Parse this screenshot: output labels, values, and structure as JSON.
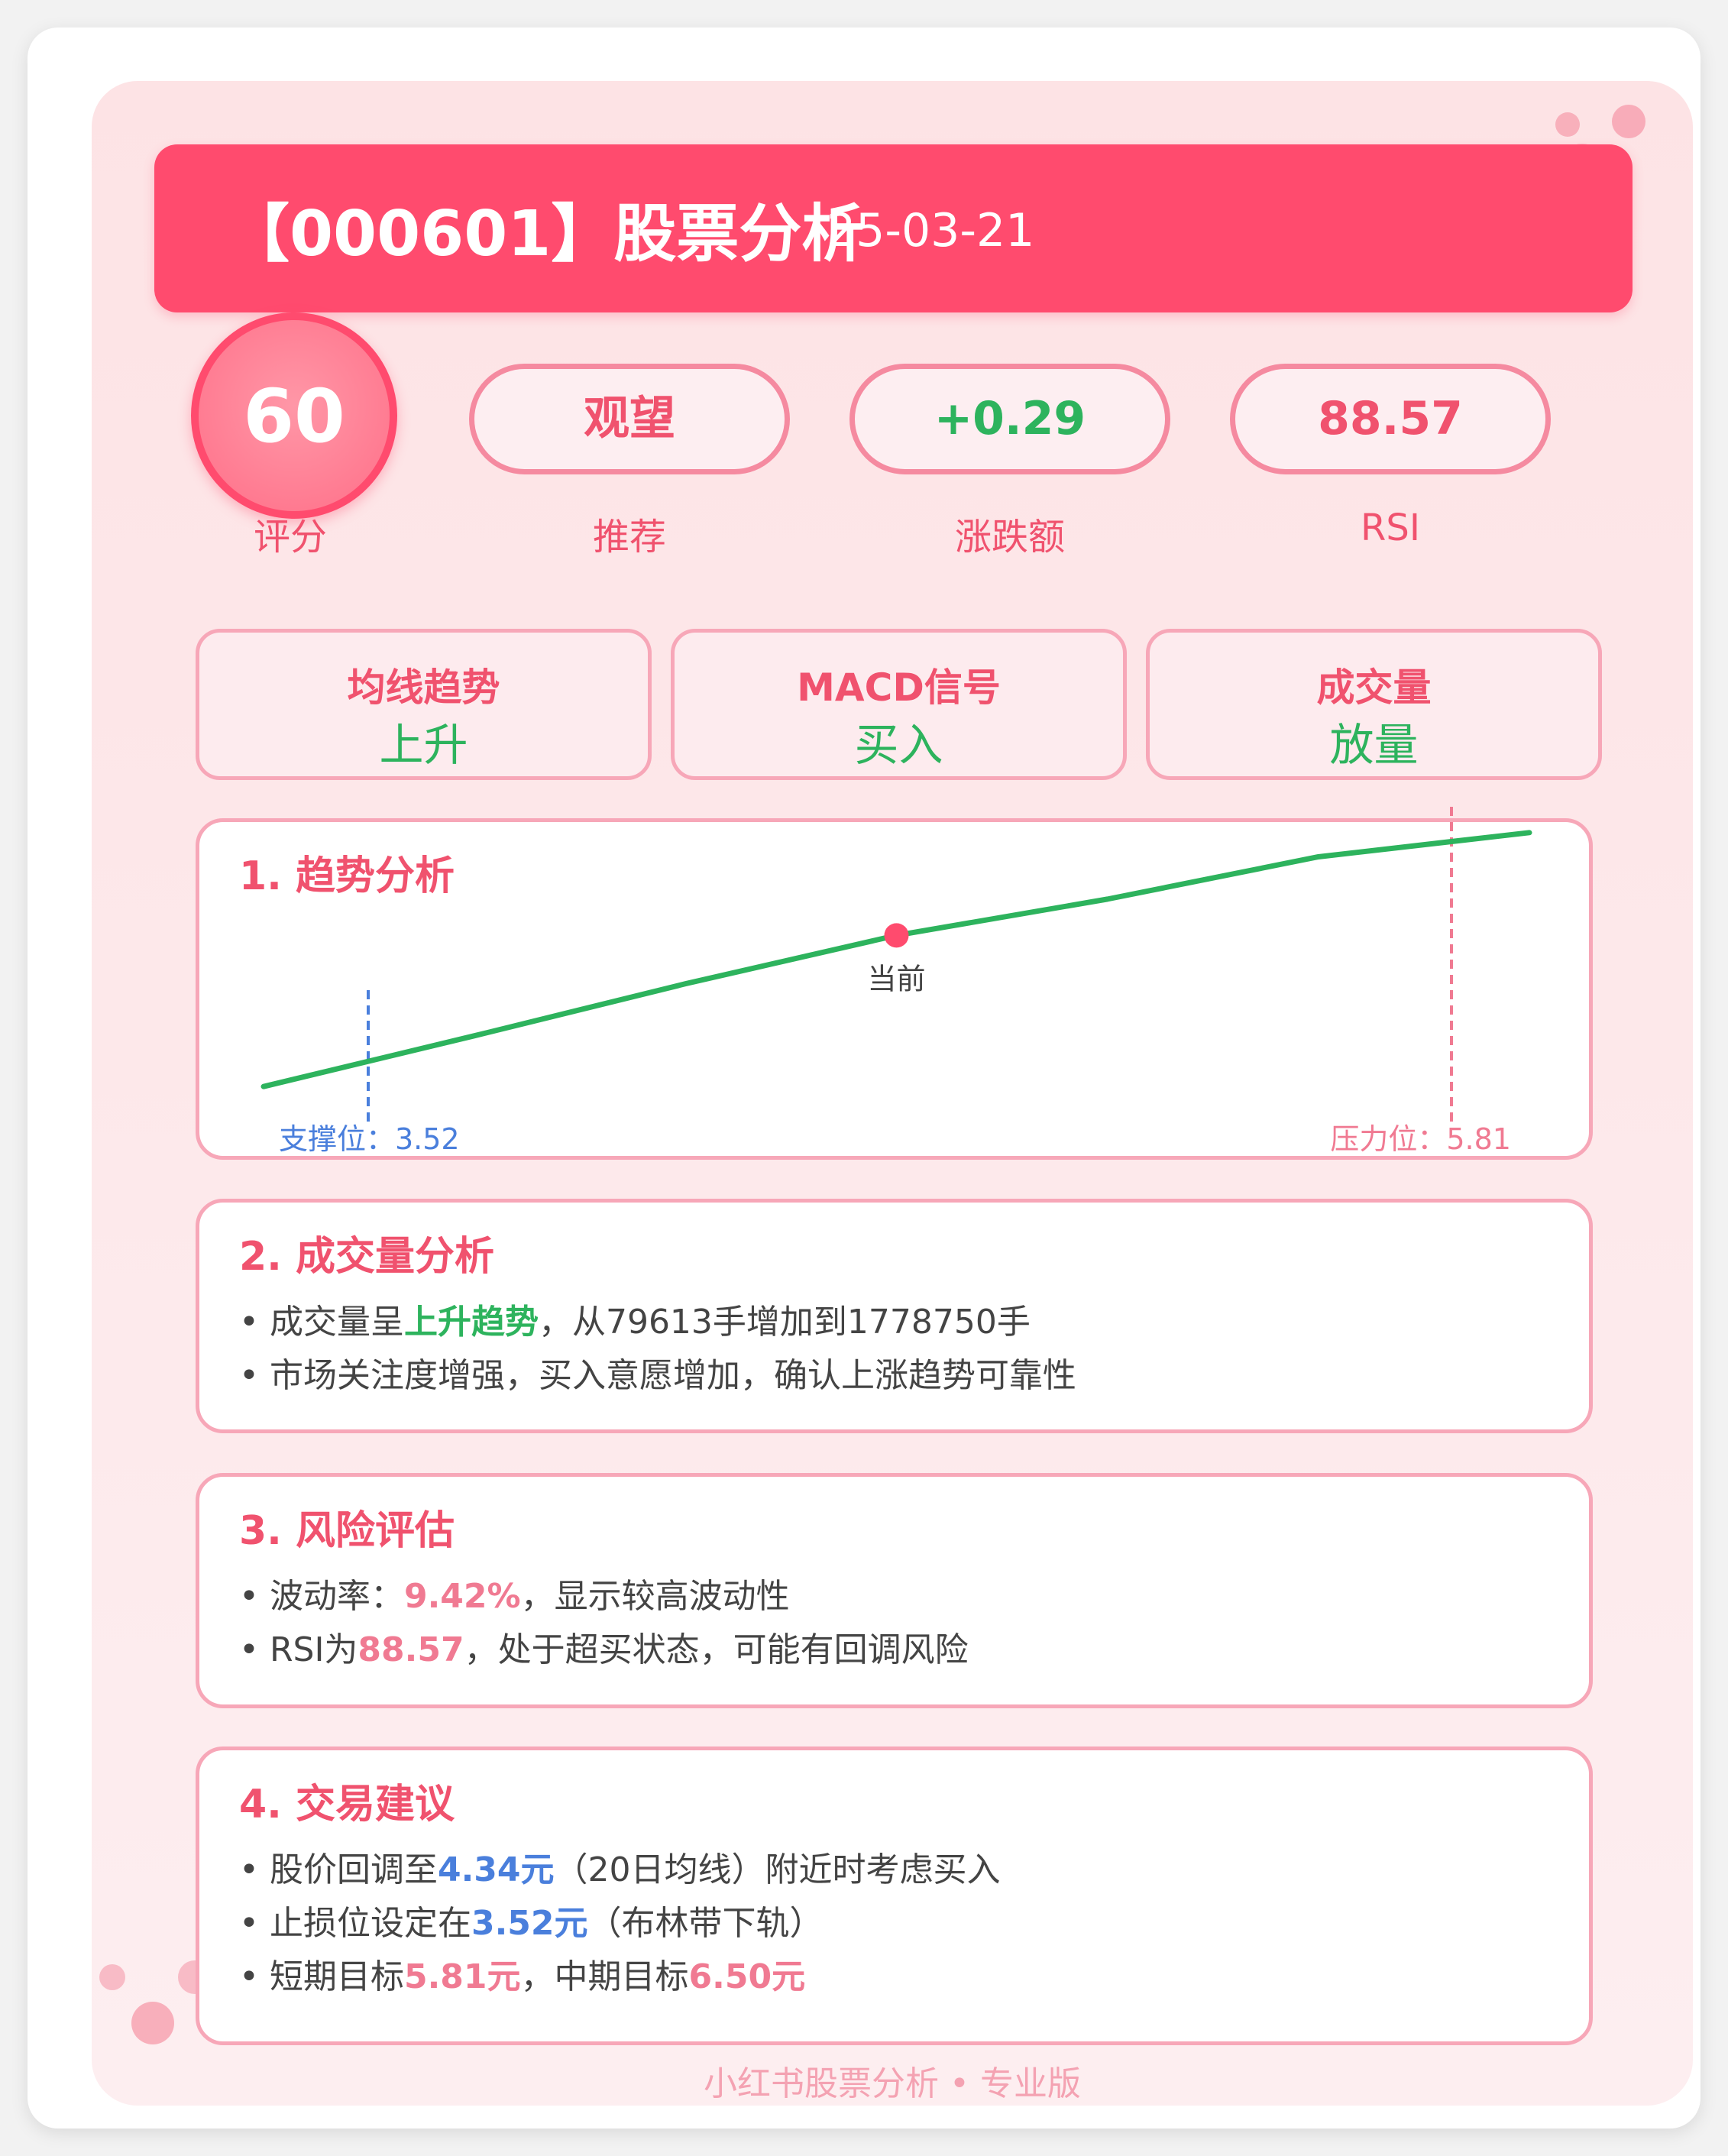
{
  "header": {
    "title": "【000601】股票分析",
    "date": "25-03-21"
  },
  "metrics": {
    "score": {
      "value": "60",
      "label": "评分"
    },
    "recommend": {
      "value": "观望",
      "label": "推荐"
    },
    "change": {
      "value": "+0.29",
      "label": "涨跌额"
    },
    "rsi": {
      "value": "88.57",
      "label": "RSI"
    }
  },
  "signals": [
    {
      "label": "均线趋势",
      "value": "上升"
    },
    {
      "label": "MACD信号",
      "value": "买入"
    },
    {
      "label": "成交量",
      "value": "放量"
    }
  ],
  "trend": {
    "title": "1. 趋势分析",
    "current_label": "当前",
    "support_label": "支撑位：3.52",
    "resistance_label": "压力位：5.81"
  },
  "chart_data": {
    "type": "line",
    "title": "1. 趋势分析",
    "x": [
      0,
      1,
      2,
      3,
      4,
      5,
      6
    ],
    "y": [
      3.3,
      3.72,
      4.15,
      4.55,
      4.85,
      5.2,
      5.4
    ],
    "current_index": 3,
    "current_label": "当前",
    "support": {
      "label": "支撑位：3.52",
      "value": 3.52
    },
    "resistance": {
      "label": "压力位：5.81",
      "value": 5.81
    },
    "colors": {
      "line": "#2db35d",
      "support": "#4a7fdc",
      "resistance": "#f07a92",
      "current": "#ff4b6e"
    },
    "grid": false
  },
  "volume": {
    "title": "2. 成交量分析",
    "b1_prefix": "• 成交量呈",
    "b1_hl": "上升趋势",
    "b1_suffix": "，从79613手增加到1778750手",
    "b2": "• 市场关注度增强，买入意愿增加，确认上涨趋势可靠性"
  },
  "risk": {
    "title": "3. 风险评估",
    "b1_prefix": "• 波动率：",
    "b1_hl": "9.42%",
    "b1_suffix": "，显示较高波动性",
    "b2_prefix": "• RSI为",
    "b2_hl": "88.57",
    "b2_suffix": "，处于超买状态，可能有回调风险"
  },
  "advice": {
    "title": "4. 交易建议",
    "b1_prefix": "• 股价回调至",
    "b1_hl": "4.34元",
    "b1_suffix": "（20日均线）附近时考虑买入",
    "b2_prefix": "• 止损位设定在",
    "b2_hl": "3.52元",
    "b2_suffix": "（布林带下轨）",
    "b3_prefix": "• 短期目标",
    "b3_hl1": "5.81元",
    "b3_mid": "，中期目标",
    "b3_hl2": "6.50元"
  },
  "footer": "小红书股票分析 • 专业版",
  "colors": {
    "primary": "#ff4b6e",
    "green": "#2db35d",
    "pink": "#f07a92",
    "blue": "#4a7fdc"
  }
}
